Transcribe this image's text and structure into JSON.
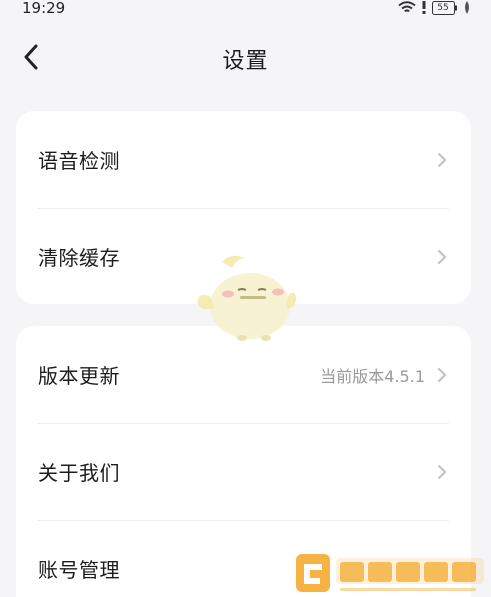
{
  "status_bar": {
    "time": "19:29",
    "battery": "55",
    "icons": [
      "wifi-icon",
      "alert-icon",
      "battery-icon",
      "leaf-icon"
    ]
  },
  "header": {
    "title": "设置",
    "back_icon": "chevron-left-icon"
  },
  "groups": [
    {
      "items": [
        {
          "label": "语音检测",
          "value": ""
        },
        {
          "label": "清除缓存",
          "value": ""
        }
      ]
    },
    {
      "items": [
        {
          "label": "版本更新",
          "value": "当前版本4.5.1"
        },
        {
          "label": "关于我们",
          "value": ""
        },
        {
          "label": "账号管理",
          "value": ""
        }
      ]
    }
  ],
  "colors": {
    "background": "#f5f5f7",
    "card": "#ffffff",
    "text": "#1c1c1c",
    "secondary_text": "#9a9a9a",
    "chevron": "#c4c4c4",
    "watermark_orange": "#f5a623"
  }
}
